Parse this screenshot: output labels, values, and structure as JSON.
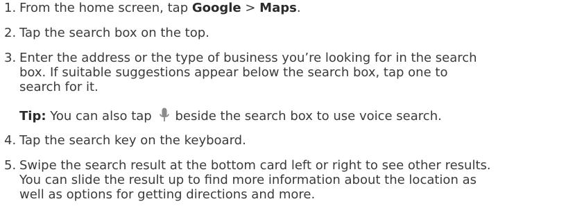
{
  "steps": [
    {
      "number": "1.",
      "pre": "From the home screen, tap ",
      "bold1": "Google",
      "sep": " > ",
      "bold2": "Maps",
      "post": "."
    },
    {
      "number": "2.",
      "text": "Tap the search box on the top."
    },
    {
      "number": "3.",
      "lines": [
        "Enter the address or the type of business you’re looking for in the search",
        "box. If suitable suggestions appear below the search box, tap one to",
        "search for it."
      ]
    },
    {
      "number": "4.",
      "text": "Tap the search key on the keyboard."
    },
    {
      "number": "5.",
      "lines": [
        "Swipe the search result at the bottom card left or right to see other results.",
        "You can slide the result up to find more information about the location as",
        "well as options for getting directions and more."
      ]
    }
  ],
  "tip": {
    "label": "Tip:",
    "pre": " You can also tap ",
    "icon": "microphone-icon",
    "post": "beside the search box to use voice search."
  },
  "colors": {
    "text": "#3a3a3a",
    "icon": "#8a8a8a"
  }
}
